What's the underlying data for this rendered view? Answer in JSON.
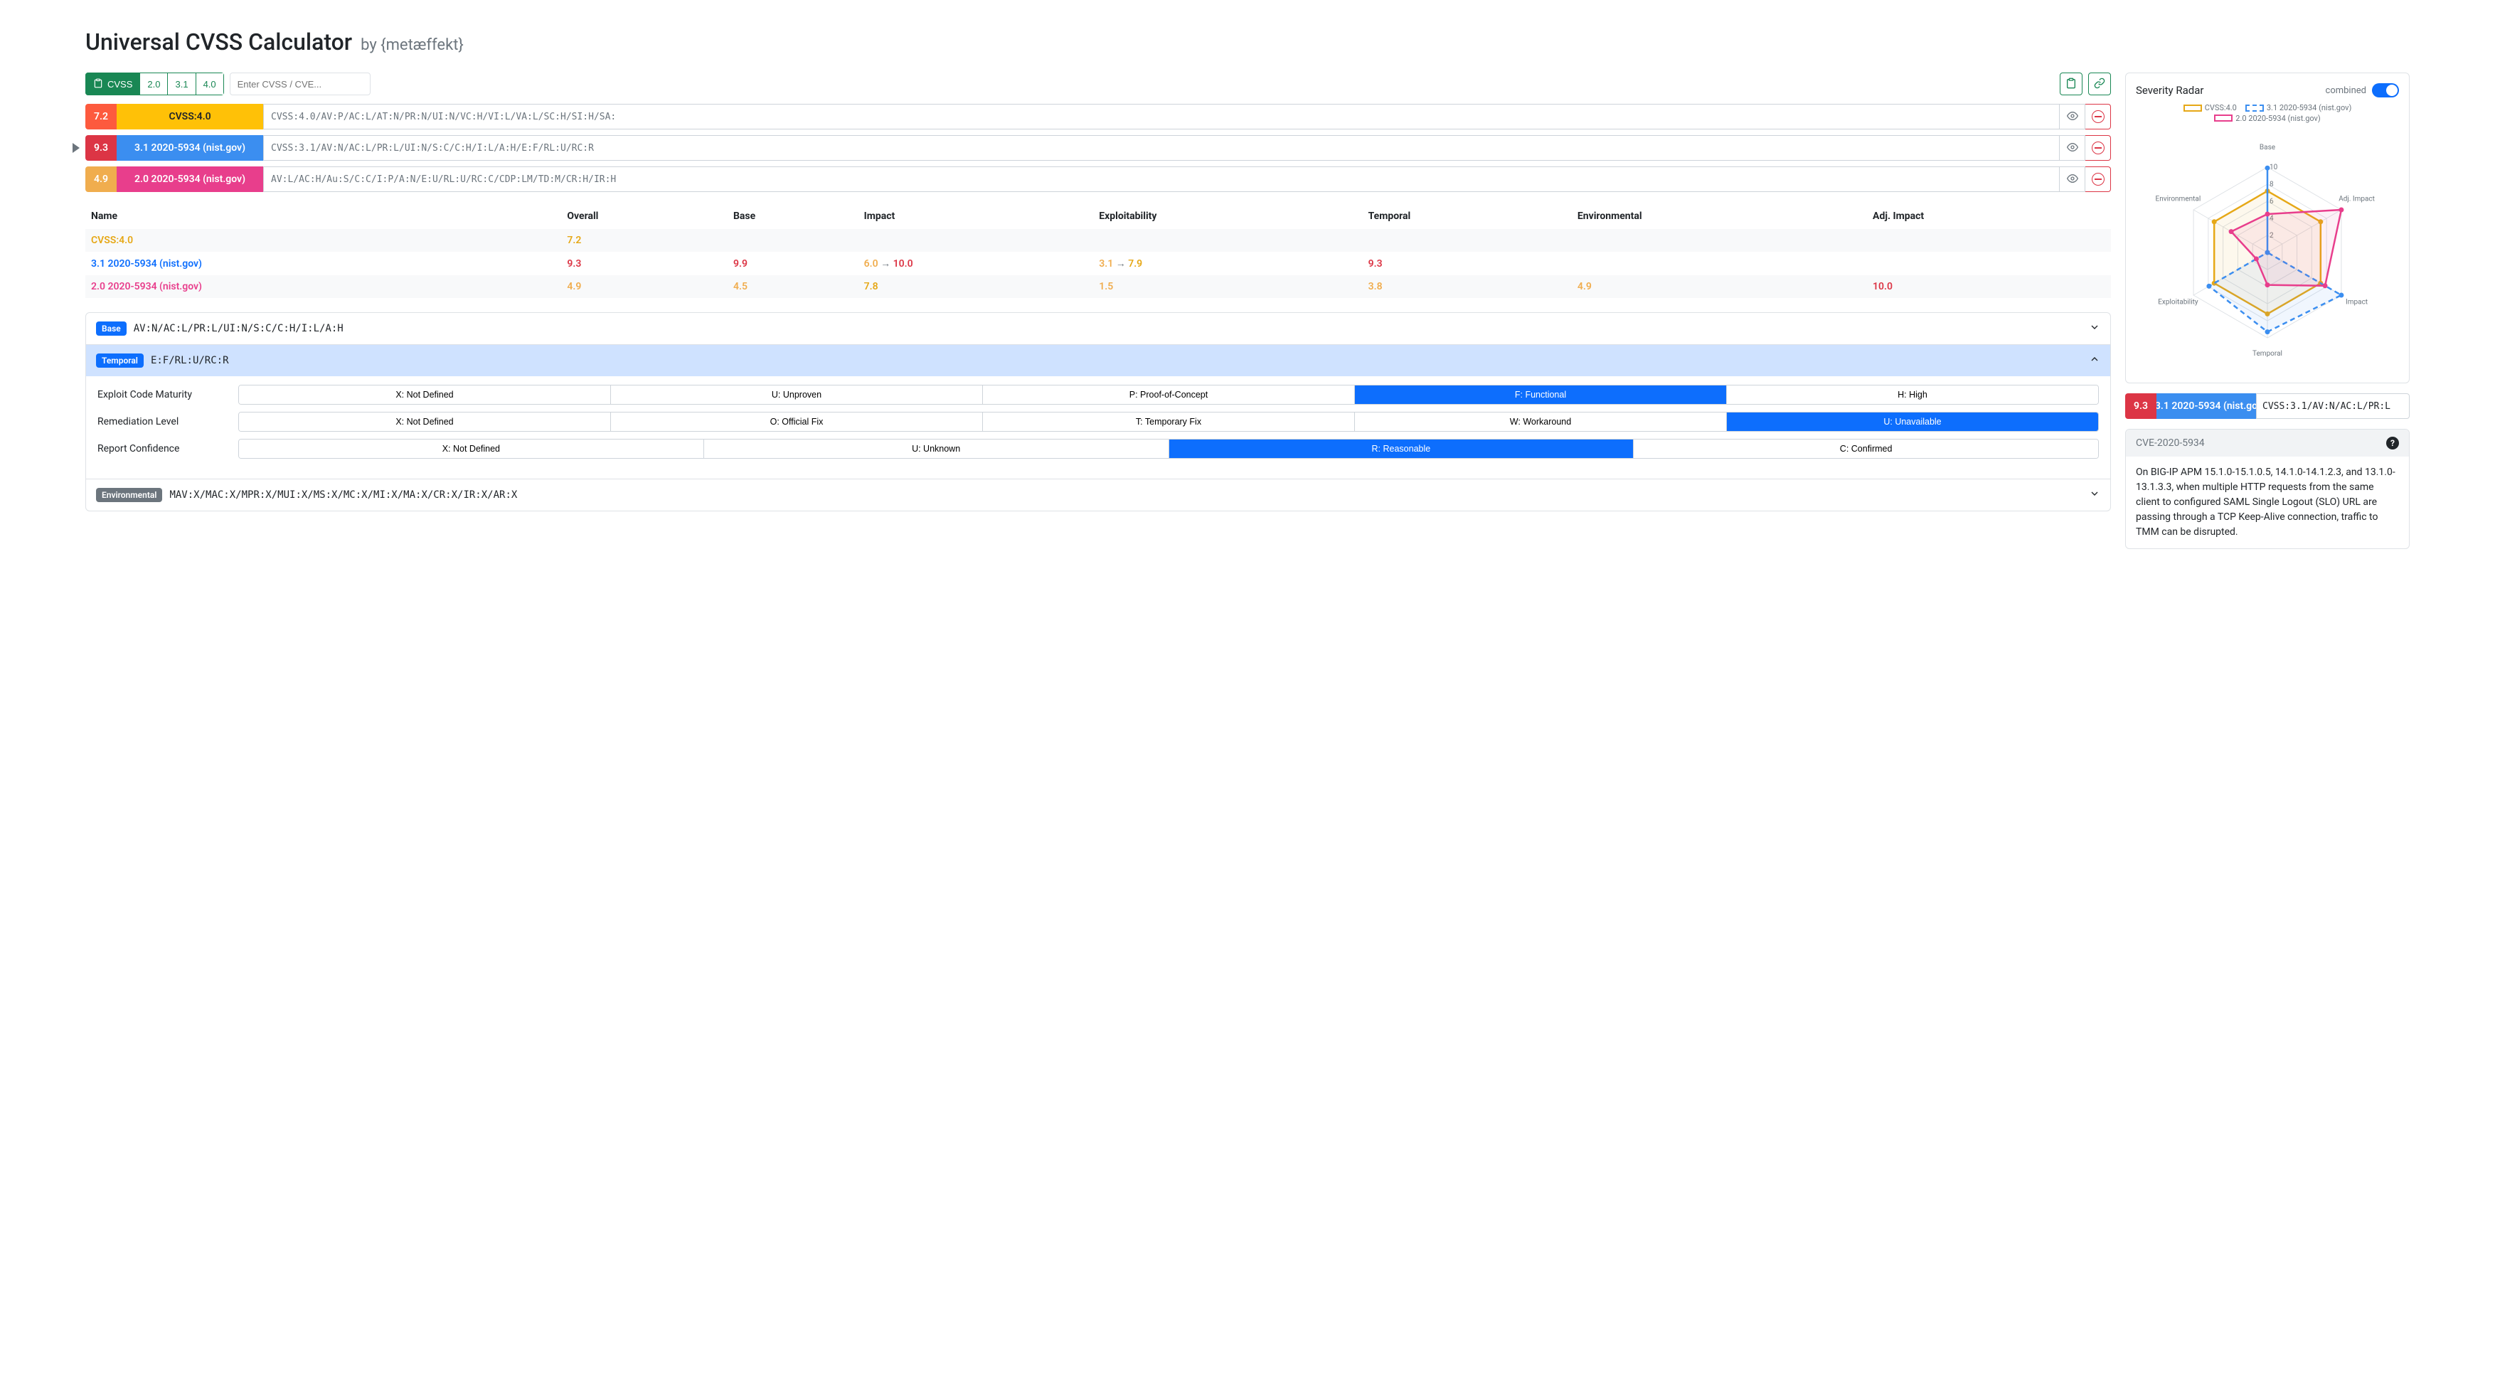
{
  "header": {
    "title": "Universal CVSS Calculator",
    "by": "by {metæffekt}"
  },
  "toolbar": {
    "cvss_label": "CVSS",
    "versions": [
      "2.0",
      "3.1",
      "4.0"
    ],
    "search_placeholder": "Enter CVSS / CVE..."
  },
  "vectors": [
    {
      "score": "7.2",
      "score_class": "bg-high",
      "name": "CVSS:4.0",
      "name_class": "bg-orange",
      "vector": "CVSS:4.0/AV:P/AC:L/AT:N/PR:N/UI:N/VC:H/VI:L/VA:L/SC:H/SI:H/SA:",
      "selected": false
    },
    {
      "score": "9.3",
      "score_class": "bg-critical",
      "name": "3.1 2020-5934 (nist.gov)",
      "name_class": "bg-blue-light",
      "vector": "CVSS:3.1/AV:N/AC:L/PR:L/UI:N/S:C/C:H/I:L/A:H/E:F/RL:U/RC:R",
      "selected": true
    },
    {
      "score": "4.9",
      "score_class": "bg-med",
      "name": "2.0 2020-5934 (nist.gov)",
      "name_class": "bg-pink",
      "vector": "AV:L/AC:H/Au:S/C:C/I:P/A:N/E:U/RL:U/RC:C/CDP:LM/TD:M/CR:H/IR:H",
      "selected": false
    }
  ],
  "table": {
    "headers": [
      "Name",
      "Overall",
      "Base",
      "Impact",
      "Exploitability",
      "Temporal",
      "Environmental",
      "Adj. Impact"
    ],
    "rows": [
      {
        "name": "CVSS:4.0",
        "name_class": "txt-orange",
        "cells": [
          {
            "text": "7.2",
            "class": "txt-orange"
          },
          {
            "text": "",
            "class": ""
          },
          {
            "text": "",
            "class": ""
          },
          {
            "text": "",
            "class": ""
          },
          {
            "text": "",
            "class": ""
          },
          {
            "text": "",
            "class": ""
          },
          {
            "text": "",
            "class": ""
          }
        ]
      },
      {
        "name": "3.1 2020-5934 (nist.gov)",
        "name_class": "txt-blue",
        "cells": [
          {
            "text": "9.3",
            "class": "txt-red"
          },
          {
            "text": "9.9",
            "class": "txt-red"
          },
          {
            "html": "<span class='txt-med'>6.0</span> <span class='arrow'>→</span> <span class='txt-red'>10.0</span>"
          },
          {
            "html": "<span class='txt-med'>3.1</span> <span class='arrow'>→</span> <span class='txt-orange'>7.9</span>"
          },
          {
            "text": "9.3",
            "class": "txt-red"
          },
          {
            "text": "",
            "class": ""
          },
          {
            "text": "",
            "class": ""
          }
        ]
      },
      {
        "name": "2.0 2020-5934 (nist.gov)",
        "name_class": "txt-pink",
        "cells": [
          {
            "text": "4.9",
            "class": "txt-med"
          },
          {
            "text": "4.5",
            "class": "txt-med"
          },
          {
            "text": "7.8",
            "class": "txt-orange"
          },
          {
            "text": "1.5",
            "class": "txt-med"
          },
          {
            "text": "3.8",
            "class": "txt-med"
          },
          {
            "text": "4.9",
            "class": "txt-med"
          },
          {
            "text": "10.0",
            "class": "txt-red"
          }
        ]
      }
    ]
  },
  "editor": {
    "base": {
      "label": "Base",
      "vector": "AV:N/AC:L/PR:L/UI:N/S:C/C:H/I:L/A:H",
      "expanded": false
    },
    "temporal": {
      "label": "Temporal",
      "vector": "E:F/RL:U/RC:R",
      "expanded": true,
      "metrics": [
        {
          "name": "Exploit Code Maturity",
          "options": [
            "X: Not Defined",
            "U: Unproven",
            "P: Proof-of-Concept",
            "F: Functional",
            "H: High"
          ],
          "selected": 3
        },
        {
          "name": "Remediation Level",
          "options": [
            "X: Not Defined",
            "O: Official Fix",
            "T: Temporary Fix",
            "W: Workaround",
            "U: Unavailable"
          ],
          "selected": 4
        },
        {
          "name": "Report Confidence",
          "options": [
            "X: Not Defined",
            "U: Unknown",
            "R: Reasonable",
            "C: Confirmed"
          ],
          "selected": 2
        }
      ]
    },
    "environmental": {
      "label": "Environmental",
      "vector": "MAV:X/MAC:X/MPR:X/MUI:X/MS:X/MC:X/MI:X/MA:X/CR:X/IR:X/AR:X",
      "expanded": false
    }
  },
  "radar": {
    "title": "Severity Radar",
    "toggle_label": "combined",
    "legend": [
      {
        "label": "CVSS:4.0",
        "class": "sw-orange"
      },
      {
        "label": "3.1 2020-5934 (nist.gov)",
        "class": "sw-blue"
      },
      {
        "label": "2.0 2020-5934 (nist.gov)",
        "class": "sw-pink"
      }
    ],
    "axes": [
      "Base",
      "Adj. Impact",
      "Impact",
      "Temporal",
      "Exploitability",
      "Environmental"
    ]
  },
  "chart_data": {
    "type": "radar",
    "axes": [
      "Base",
      "Adj. Impact",
      "Impact",
      "Temporal",
      "Exploitability",
      "Environmental"
    ],
    "range": [
      0,
      10
    ],
    "ticks": [
      2,
      4,
      6,
      8,
      10
    ],
    "series": [
      {
        "name": "CVSS:4.0",
        "color": "#e6a817",
        "dash": false,
        "values": [
          7.2,
          7.2,
          7.2,
          7.2,
          7.2,
          7.2
        ]
      },
      {
        "name": "3.1 2020-5934 (nist.gov)",
        "color": "#3b8ef0",
        "dash": true,
        "values": [
          9.9,
          0.0,
          10.0,
          9.3,
          7.9,
          0.0
        ]
      },
      {
        "name": "2.0 2020-5934 (nist.gov)",
        "color": "#e83e8c",
        "dash": false,
        "values": [
          4.5,
          10.0,
          7.8,
          3.8,
          1.5,
          4.9
        ]
      }
    ]
  },
  "selected_summary": {
    "score": "9.3",
    "score_class": "bg-critical",
    "name": "3.1 2020-5934 (nist.go",
    "name_class": "bg-blue-light",
    "vector": "CVSS:3.1/AV:N/AC:L/PR:L"
  },
  "cve": {
    "id": "CVE-2020-5934",
    "description": "On BIG-IP APM 15.1.0-15.1.0.5, 14.1.0-14.1.2.3, and 13.1.0-13.1.3.3, when multiple HTTP requests from the same client to configured SAML Single Logout (SLO) URL are passing through a TCP Keep-Alive connection, traffic to TMM can be disrupted."
  }
}
